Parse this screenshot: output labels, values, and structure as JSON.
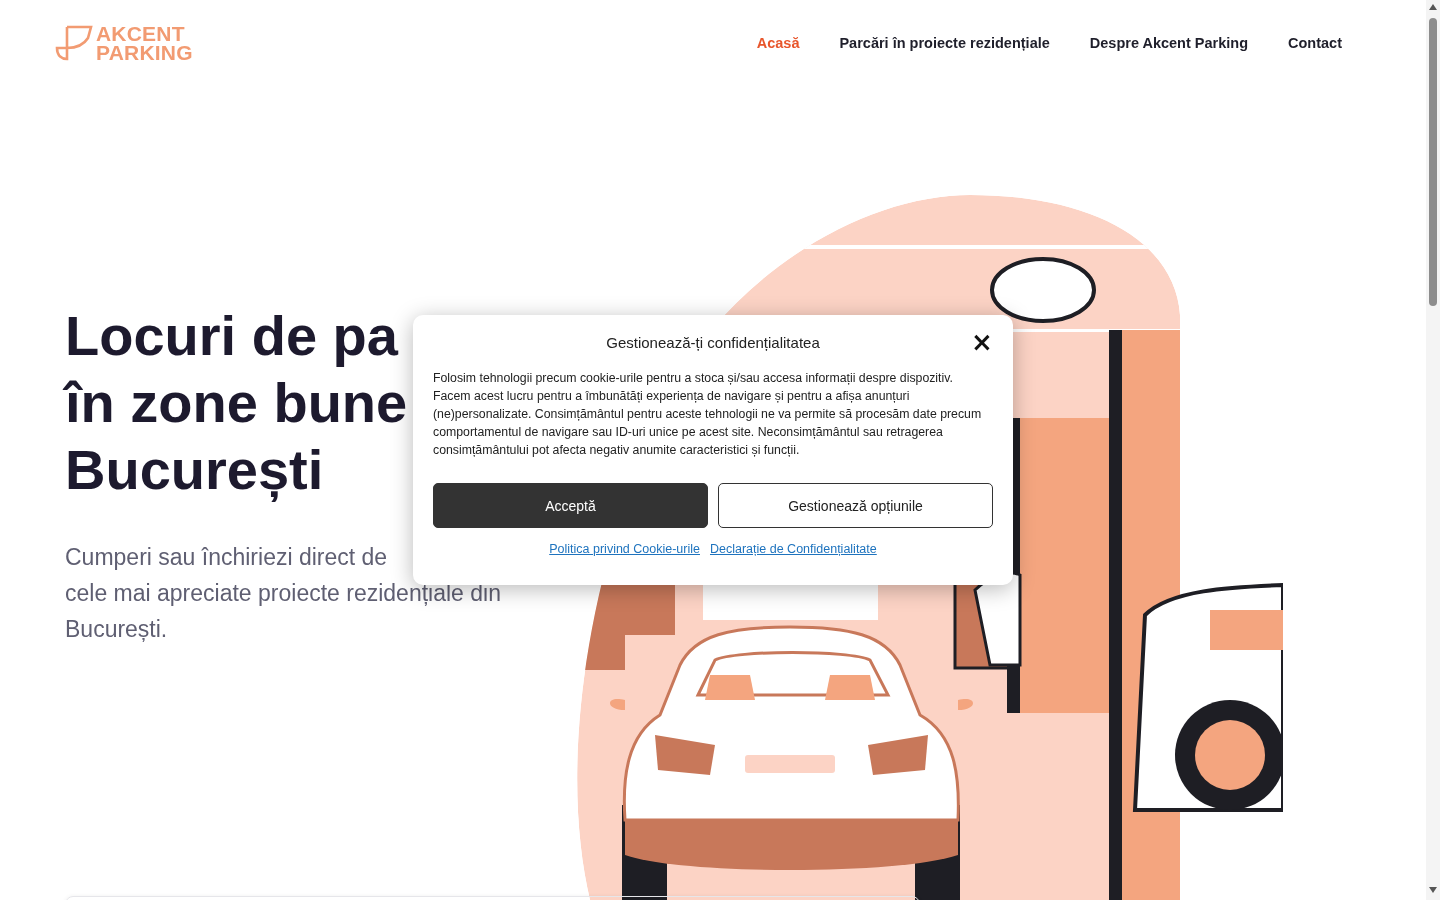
{
  "header": {
    "logo": {
      "lines": [
        "AKCENT",
        "PARKING"
      ]
    },
    "nav": [
      {
        "label": "Acasă",
        "selected": true
      },
      {
        "label": "Parcări în proiecte rezidențiale",
        "selected": false
      },
      {
        "label": "Despre Akcent Parking",
        "selected": false
      },
      {
        "label": "Contact",
        "selected": false
      }
    ]
  },
  "hero": {
    "heading_lines": [
      "Locuri de pa",
      "în zone bune",
      "București"
    ],
    "text_lines": [
      "Cumperi sau închiriezi direct de",
      "cele mai apreciate proiecte rezidențiale din",
      "București."
    ],
    "illustration": {
      "kind": "picture"
    }
  },
  "cookie_dialog": {
    "title": "Gestionează-ți confidențialitatea",
    "close": "×",
    "body": "Folosim tehnologii precum cookie-urile pentru a stoca și/sau accesa informații despre dispozitiv. Facem acest lucru pentru a îmbunătăți experiența de navigare și pentru a afișa anunțuri (ne)personalizate. Consimțământul pentru aceste tehnologii ne va permite să procesăm date precum comportamentul de navigare sau ID-uri unice pe acest site. Neconsimțământul sau retragerea consimțământului pot afecta negativ anumite caracteristici și funcții.",
    "buttons": [
      {
        "label": "Acceptă",
        "kind": "primary"
      },
      {
        "label": "Gestionează opțiunile",
        "kind": "secondary"
      }
    ],
    "links": [
      "Politica privind Cookie-urile",
      "Declarație de Confidențialitate"
    ]
  }
}
